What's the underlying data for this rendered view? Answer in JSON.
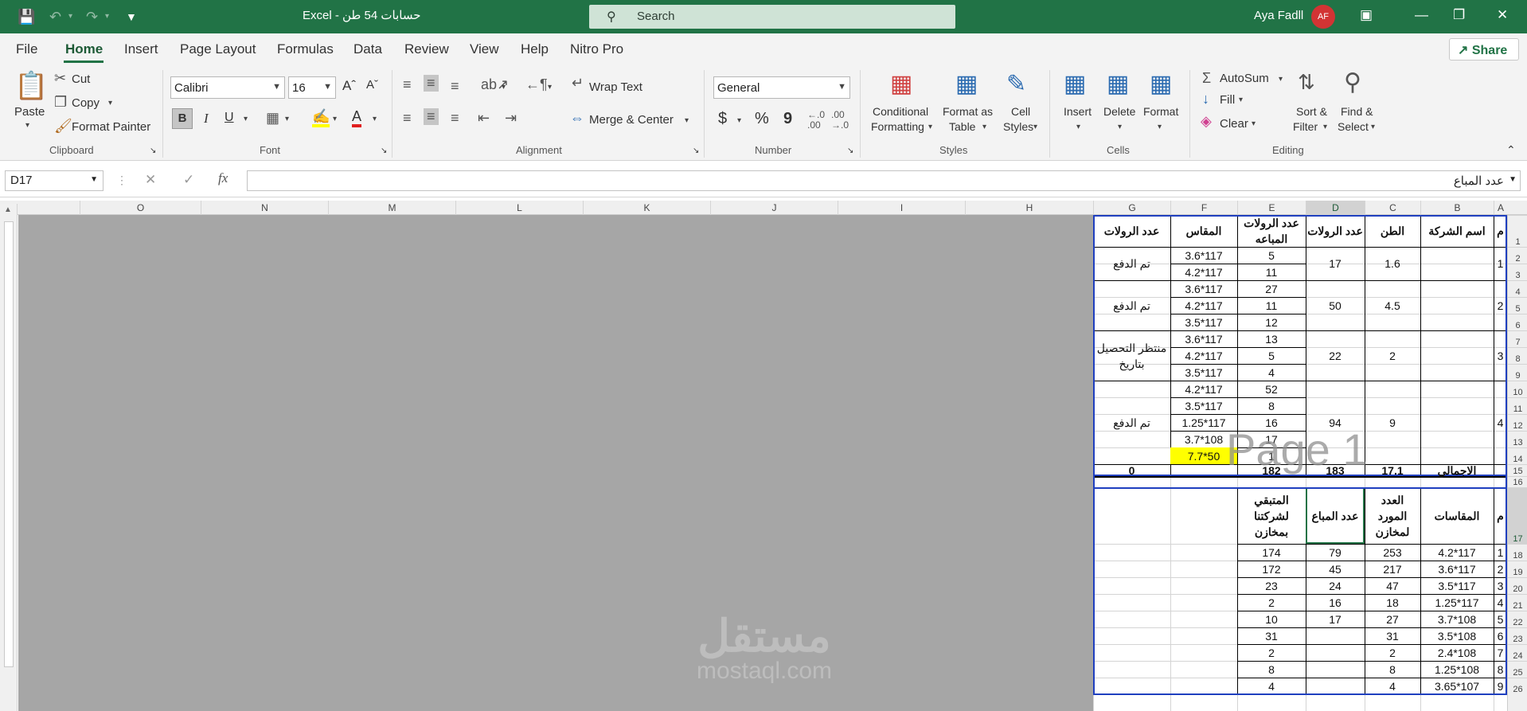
{
  "titlebar": {
    "doc_title": "حسابات 54 طن  -  Excel",
    "search_label": "Search",
    "user_name": "Aya Fadll",
    "avatar_initials": "AF"
  },
  "menu": {
    "tabs": [
      "File",
      "Home",
      "Insert",
      "Page Layout",
      "Formulas",
      "Data",
      "Review",
      "View",
      "Help",
      "Nitro Pro"
    ],
    "share": "Share"
  },
  "ribbon": {
    "clipboard": {
      "paste": "Paste",
      "cut": "Cut",
      "copy": "Copy",
      "format_painter": "Format Painter",
      "label": "Clipboard"
    },
    "font": {
      "name": "Calibri",
      "size": "16",
      "bold": "B",
      "italic": "I",
      "underline": "U",
      "label": "Font"
    },
    "alignment": {
      "wrap": "Wrap Text",
      "merge": "Merge & Center",
      "label": "Alignment"
    },
    "number": {
      "format": "General",
      "currency": "$",
      "percent": "%",
      "comma": "9",
      "label": "Number"
    },
    "styles": {
      "cond_a": "Conditional",
      "cond_b": "Formatting",
      "fat_a": "Format as",
      "fat_b": "Table",
      "cs_a": "Cell",
      "cs_b": "Styles",
      "label": "Styles"
    },
    "cells": {
      "insert": "Insert",
      "delete": "Delete",
      "format": "Format",
      "label": "Cells"
    },
    "editing": {
      "autosum": "AutoSum",
      "fill": "Fill",
      "clear": "Clear",
      "sort_a": "Sort &",
      "sort_b": "Filter",
      "find_a": "Find &",
      "find_b": "Select",
      "label": "Editing"
    }
  },
  "formula": {
    "namebox": "D17",
    "content": "عدد المباع"
  },
  "columns": [
    "O",
    "N",
    "M",
    "L",
    "K",
    "J",
    "I",
    "H",
    "G",
    "F",
    "E",
    "D",
    "C",
    "B",
    "A"
  ],
  "rows": [
    "1",
    "2",
    "3",
    "4",
    "5",
    "6",
    "7",
    "8",
    "9",
    "10",
    "11",
    "12",
    "13",
    "14",
    "15",
    "16",
    "17",
    "18",
    "19",
    "20",
    "21",
    "22",
    "23",
    "24",
    "25",
    "26"
  ],
  "table1": {
    "headers": {
      "m": "م",
      "company": "اسم الشركة",
      "ton": "الطن",
      "rolls": "عدد الرولات",
      "sold": "عدد الرولات المباعه",
      "size": "المقاس",
      "g": "عدد الرولات"
    },
    "groups": [
      {
        "m": "1",
        "ton": "1.6",
        "rolls": "17",
        "status": "تم الدفع",
        "items": [
          {
            "sold": "5",
            "size": "117*3.6"
          },
          {
            "sold": "11",
            "size": "117*4.2"
          }
        ]
      },
      {
        "m": "2",
        "ton": "4.5",
        "rolls": "50",
        "status": "تم الدفع",
        "items": [
          {
            "sold": "27",
            "size": "117*3.6"
          },
          {
            "sold": "11",
            "size": "117*4.2"
          },
          {
            "sold": "12",
            "size": "117*3.5"
          }
        ]
      },
      {
        "m": "3",
        "ton": "2",
        "rolls": "22",
        "status": "منتظر التحصيل بتاريخ",
        "items": [
          {
            "sold": "13",
            "size": "117*3.6"
          },
          {
            "sold": "5",
            "size": "117*4.2"
          },
          {
            "sold": "4",
            "size": "117*3.5"
          }
        ]
      },
      {
        "m": "4",
        "ton": "9",
        "rolls": "94",
        "status": "تم الدفع",
        "items": [
          {
            "sold": "52",
            "size": "117*4.2"
          },
          {
            "sold": "8",
            "size": "117*3.5"
          },
          {
            "sold": "16",
            "size": "117*1.25"
          },
          {
            "sold": "17",
            "size": "108*3.7"
          },
          {
            "sold": "1",
            "size": "50*7.7"
          }
        ]
      }
    ],
    "total": {
      "label": "الاجمالي",
      "ton": "17.1",
      "rolls": "183",
      "sold": "182",
      "g": "0"
    }
  },
  "table2": {
    "headers": {
      "m": "م",
      "sizes": "المقاسات",
      "supplied": "العدد المورد لمخازن",
      "sold": "عدد المباع",
      "remaining": "المتبقي لشركتنا بمخازن"
    },
    "rows": [
      {
        "m": "1",
        "size": "117*4.2",
        "supplied": "253",
        "sold": "79",
        "remaining": "174"
      },
      {
        "m": "2",
        "size": "117*3.6",
        "supplied": "217",
        "sold": "45",
        "remaining": "172"
      },
      {
        "m": "3",
        "size": "117*3.5",
        "supplied": "47",
        "sold": "24",
        "remaining": "23"
      },
      {
        "m": "4",
        "size": "117*1.25",
        "supplied": "18",
        "sold": "16",
        "remaining": "2"
      },
      {
        "m": "5",
        "size": "108*3.7",
        "supplied": "27",
        "sold": "17",
        "remaining": "10"
      },
      {
        "m": "6",
        "size": "108*3.5",
        "supplied": "31",
        "sold": "",
        "remaining": "31"
      },
      {
        "m": "7",
        "size": "108*2.4",
        "supplied": "2",
        "sold": "",
        "remaining": "2"
      },
      {
        "m": "8",
        "size": "108*1.25",
        "supplied": "8",
        "sold": "",
        "remaining": "8"
      },
      {
        "m": "9",
        "size": "107*3.65",
        "supplied": "4",
        "sold": "",
        "remaining": "4"
      }
    ]
  },
  "watermark": "Page 1",
  "logo": {
    "arabic": "مستقل",
    "latin": "mostaql.com"
  }
}
